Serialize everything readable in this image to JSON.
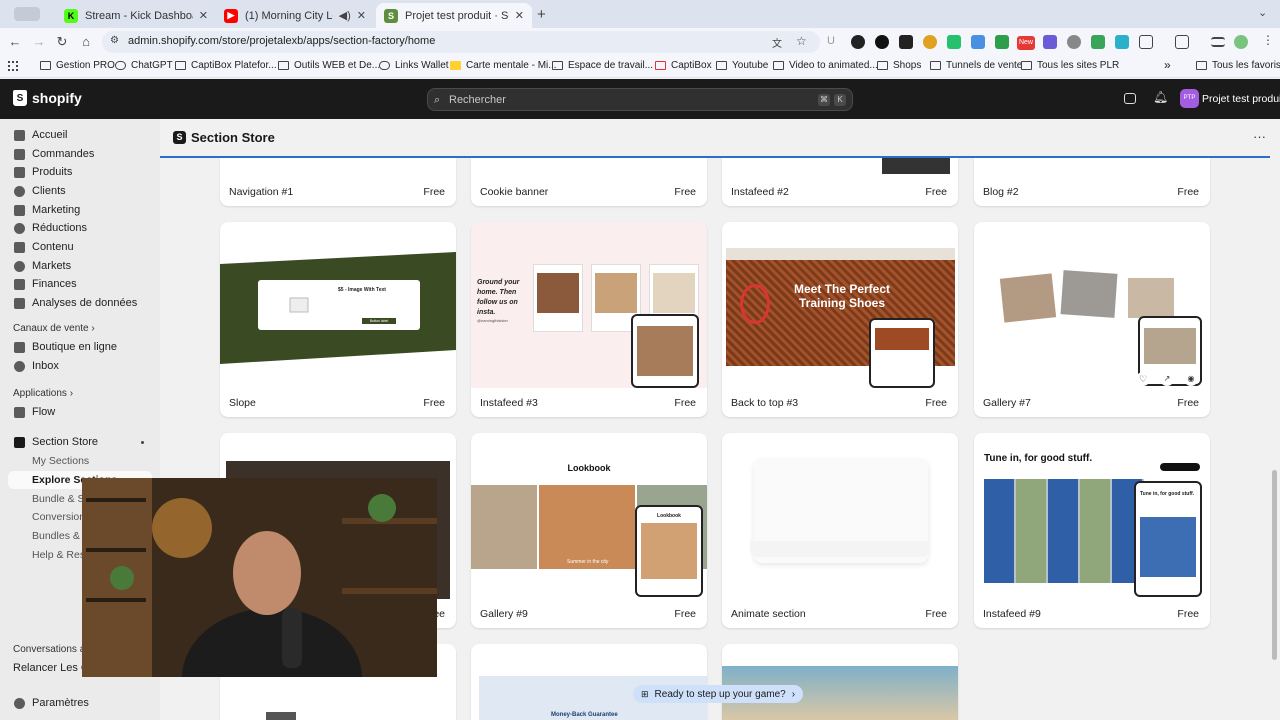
{
  "browser": {
    "tabs": [
      {
        "title": "Stream - Kick Dashboard"
      },
      {
        "title": "(1) Morning City Lofi Beat"
      },
      {
        "title": "Projet test produit · Section S"
      }
    ],
    "url": "admin.shopify.com/store/projetalexb/apps/section-factory/home",
    "ext_new_badge": "New",
    "bookmarks": [
      "Gestion PRO",
      "ChatGPT",
      "CaptiBox Platefor...",
      "Outils WEB et De...",
      "Links Wallet",
      "Carte mentale - Mi...",
      "Espace de travail...",
      "CaptiBox",
      "Youtube",
      "Video to animated...",
      "Shops",
      "Tunnels de vente",
      "Tous les sites PLR"
    ],
    "bookmarks_more": "»",
    "all_bookmarks": "Tous les favoris"
  },
  "topbar": {
    "brand": "shopify",
    "search_placeholder": "Rechercher",
    "kbd1": "⌘",
    "kbd2": "K",
    "store_initials": "PTP",
    "store_name": "Projet test produit"
  },
  "sidebar": {
    "items": [
      "Accueil",
      "Commandes",
      "Produits",
      "Clients",
      "Marketing",
      "Réductions",
      "Contenu",
      "Markets",
      "Finances",
      "Analyses de données"
    ],
    "sales_channels_label": "Canaux de vente",
    "sales_channels": [
      "Boutique en ligne",
      "Inbox"
    ],
    "apps_label": "Applications",
    "apps": [
      "Flow"
    ],
    "section_store": "Section Store",
    "section_store_sub": [
      "My Sections",
      "Explore Sections",
      "Bundle & Sa",
      "Conversion",
      "Bundles & Q",
      "Help & Reso"
    ],
    "conversations_label": "Conversations ave",
    "relancer": "Relancer Les Cli",
    "settings": "Paramètres"
  },
  "main": {
    "title": "Section Store",
    "menu_icon": "···",
    "price_label": "Free",
    "cards": [
      {
        "name": "Navigation #1"
      },
      {
        "name": "Cookie banner"
      },
      {
        "name": "Instafeed #2"
      },
      {
        "name": "Blog #2"
      },
      {
        "name": "Slope"
      },
      {
        "name": "Instafeed #3"
      },
      {
        "name": "Back to top #3"
      },
      {
        "name": "Gallery #7"
      },
      {
        "name": ""
      },
      {
        "name": "Gallery #9"
      },
      {
        "name": "Animate section"
      },
      {
        "name": "Instafeed #9"
      }
    ],
    "slope_thumb": {
      "heading": "$5 - Image With Text",
      "button": "Button label"
    },
    "instafeed3_thumb": {
      "text": "Ground your home. Then follow us on insta.",
      "handle": "@namingthisister"
    },
    "backtotop_thumb": {
      "heading": "Meet The Perfect Training Shoes"
    },
    "lookbook_thumb": {
      "heading": "Lookbook",
      "caption": "Summer in the city"
    },
    "instafeed9_thumb": {
      "heading": "Tune in, for good stuff."
    },
    "money_back": "Money-Back Guarantee"
  },
  "toast": {
    "label": "Ready to step up your game?",
    "arrow": "›"
  }
}
